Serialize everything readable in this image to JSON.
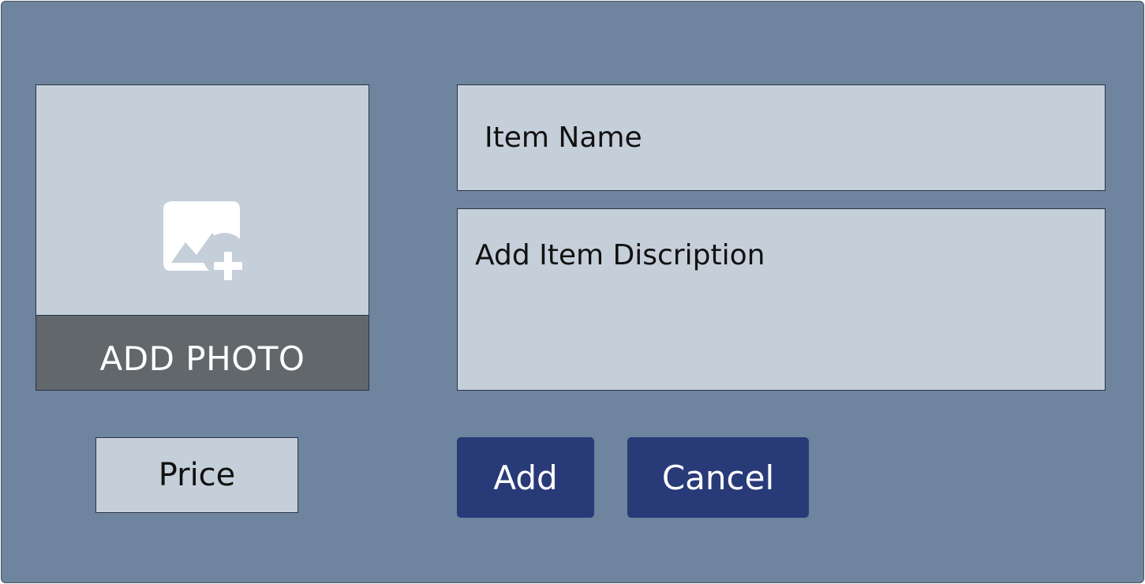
{
  "photo": {
    "label": "ADD PHOTO",
    "icon": "add-photo-icon"
  },
  "form": {
    "item_name_placeholder": "Item Name",
    "description_placeholder": "Add Item Discription",
    "price_placeholder": "Price"
  },
  "actions": {
    "add_label": "Add",
    "cancel_label": "Cancel"
  },
  "colors": {
    "panel": "#6e849f",
    "field": "#c5cfda",
    "photo_label_bg": "#62676c",
    "button": "#283a78"
  }
}
